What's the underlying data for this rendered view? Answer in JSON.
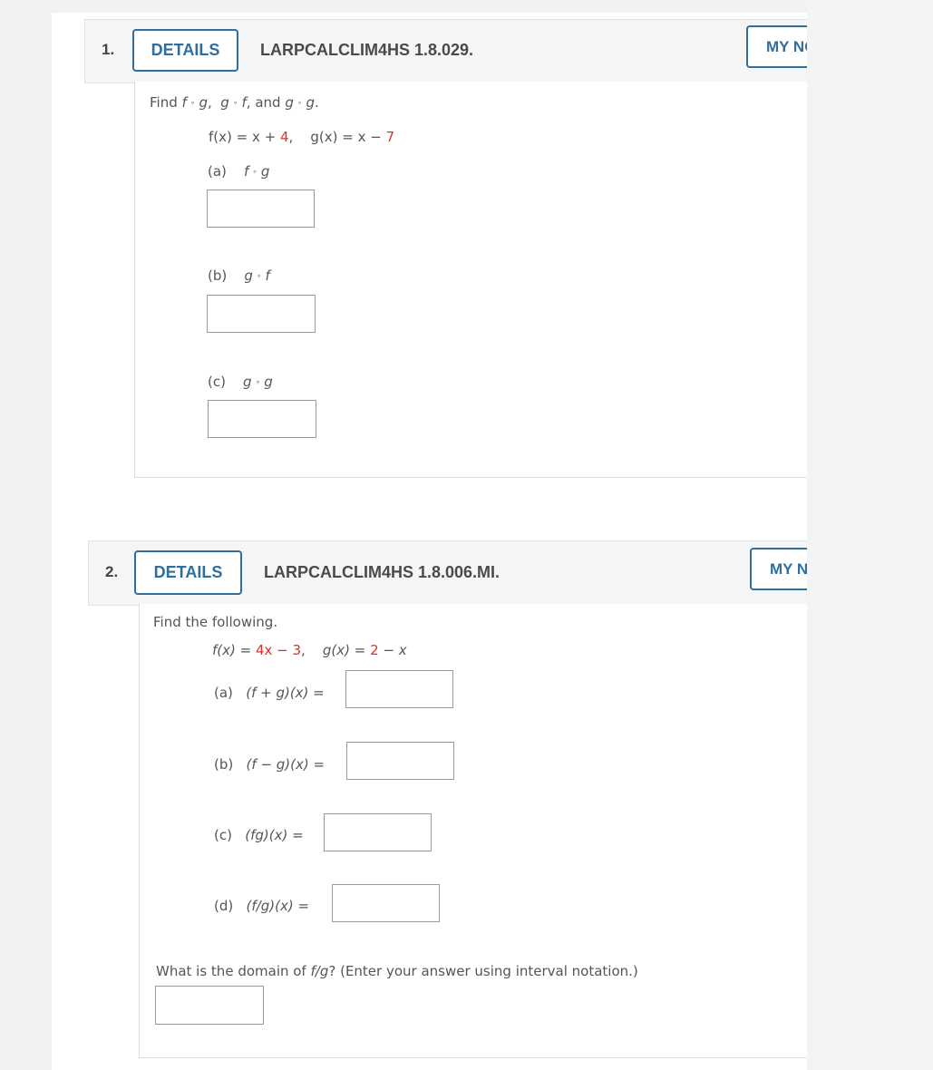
{
  "questions": [
    {
      "number": "1.",
      "details_label": "DETAILS",
      "code": "LARPCALCLIM4HS 1.8.029.",
      "my_notes_label": "MY NOTES",
      "prompt": {
        "find": "Find",
        "f": "f",
        "g": "g",
        "comp": "∘",
        "sep": ",",
        "and": "and",
        "end": "."
      },
      "functions": {
        "f_lhs": "f(x) = x + ",
        "f_const": "4",
        "f_sep": ",",
        "g_lhs": "g(x) = x − ",
        "g_const": "7"
      },
      "parts": [
        {
          "label": "(a)",
          "left": "f",
          "right": "g",
          "answer": ""
        },
        {
          "label": "(b)",
          "left": "g",
          "right": "f",
          "answer": ""
        },
        {
          "label": "(c)",
          "left": "g",
          "right": "g",
          "answer": ""
        }
      ]
    },
    {
      "number": "2.",
      "details_label": "DETAILS",
      "code": "LARPCALCLIM4HS 1.8.006.MI.",
      "my_notes_label": "MY NOTES",
      "prompt": "Find the following.",
      "functions": {
        "f_lhs": "f(x) = ",
        "f_expr": "4x − 3",
        "f_sep": ",",
        "g_lhs": "g(x) = ",
        "g_expr_red": "2",
        "g_expr_rest": " − x"
      },
      "parts": [
        {
          "label": "(a)",
          "expr": "(f + g)(x) =",
          "answer": ""
        },
        {
          "label": "(b)",
          "expr": "(f − g)(x) =",
          "answer": ""
        },
        {
          "label": "(c)",
          "expr": "(fg)(x) =",
          "answer": ""
        },
        {
          "label": "(d)",
          "expr": "(f/g)(x) =",
          "answer": ""
        }
      ],
      "domain_question": {
        "pre": "What is the domain of ",
        "expr": "f/g",
        "post": "?  (Enter your answer using interval notation.)",
        "answer": ""
      }
    }
  ],
  "colors": {
    "accent": "#2f6f9f",
    "highlight_red": "#d9322b"
  }
}
